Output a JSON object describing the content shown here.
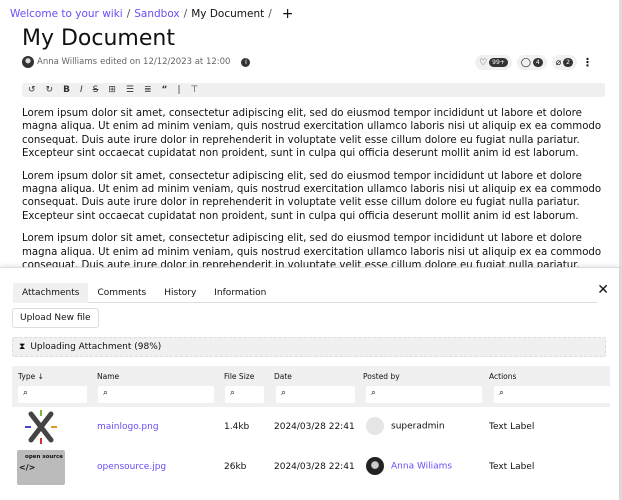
{
  "breadcrumb": {
    "items": [
      "Welcome to your wiki",
      "Sandbox"
    ],
    "current": "My Document",
    "add_icon": "plus-icon"
  },
  "page": {
    "title": "My Document",
    "author": "Anna Williams",
    "edited_text": "edited on 12/12/2023 at 12:00"
  },
  "badges": {
    "likes": "99+",
    "comments": "4",
    "attachments": "2"
  },
  "toolbar": [
    "undo-icon",
    "redo-icon",
    "bold-icon",
    "italic-icon",
    "strikethrough-icon",
    "table-icon",
    "bullet-list-icon",
    "numbered-list-icon",
    "quote-icon",
    "divider-icon",
    "pin-icon"
  ],
  "content": {
    "paragraphs": [
      "Lorem ipsum dolor sit amet, consectetur adipiscing elit, sed do eiusmod tempor incididunt ut labore et dolore magna aliqua. Ut enim ad minim veniam, quis nostrud exercitation ullamco laboris nisi ut aliquip ex ea commodo consequat. Duis aute irure dolor in reprehenderit in voluptate velit esse cillum dolore eu fugiat nulla pariatur. Excepteur sint occaecat cupidatat non proident, sunt in culpa qui officia deserunt mollit anim id est laborum.",
      "Lorem ipsum dolor sit amet, consectetur adipiscing elit, sed do eiusmod tempor incididunt ut labore et dolore magna aliqua. Ut enim ad minim veniam, quis nostrud exercitation ullamco laboris nisi ut aliquip ex ea commodo consequat. Duis aute irure dolor in reprehenderit in voluptate velit esse cillum dolore eu fugiat nulla pariatur. Excepteur sint occaecat cupidatat non proident, sunt in culpa qui officia deserunt mollit anim id est laborum.",
      "Lorem ipsum dolor sit amet, consectetur adipiscing elit, sed do eiusmod tempor incididunt ut labore et dolore magna aliqua. Ut enim ad minim veniam, quis nostrud exercitation ullamco laboris nisi ut aliquip ex ea commodo consequat. Duis aute irure dolor in reprehenderit in voluptate velit esse cillum dolore eu fugiat nulla pariatur."
    ]
  },
  "panel": {
    "tabs": [
      "Attachments",
      "Comments",
      "History",
      "Information"
    ],
    "active_tab": "Attachments",
    "upload_label": "Upload New file",
    "progress_label": "Uploading Attachment (98%)",
    "progress": 98
  },
  "table": {
    "headers": [
      "Type",
      "Name",
      "File Size",
      "Date",
      "Posted by",
      "Actions"
    ],
    "rows": [
      {
        "name": "mainlogo.png",
        "size": "1.4kb",
        "date": "2024/03/28 22:41",
        "posted_by": "superadmin",
        "action": "Text Label"
      },
      {
        "name": "opensource.jpg",
        "size": "26kb",
        "date": "2024/03/28 22:41",
        "posted_by": "Anna Wiliams",
        "action": "Text Label",
        "thumb_text": "open source"
      }
    ]
  },
  "colors": {
    "link": "#6b4cf6"
  }
}
